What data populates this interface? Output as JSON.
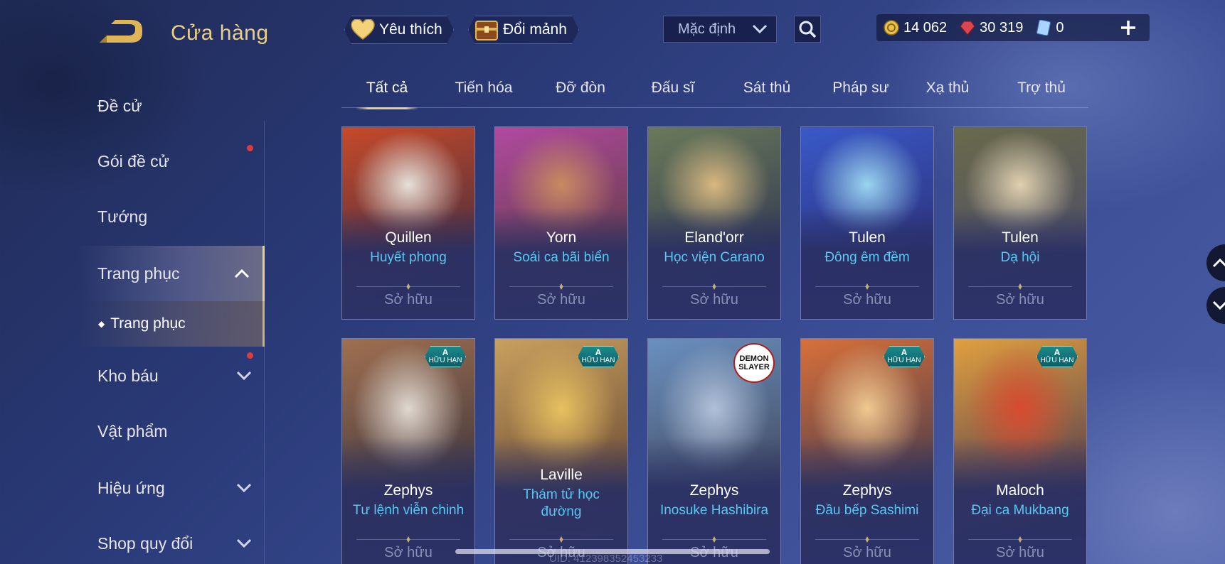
{
  "header": {
    "title": "Cửa hàng",
    "favorites_label": "Yêu thích",
    "exchange_label": "Đổi mảnh",
    "sort_value": "Mặc định"
  },
  "currencies": [
    {
      "name": "gold",
      "value": "14 062",
      "color": "#e8c04a"
    },
    {
      "name": "gem",
      "value": "30 319",
      "color": "#d8474f"
    },
    {
      "name": "voucher",
      "value": "0",
      "color": "#7fb6f0"
    }
  ],
  "sidebar": {
    "items": [
      {
        "label": "Đề cử"
      },
      {
        "label": "Gói đề cử"
      },
      {
        "label": "Tướng"
      },
      {
        "label": "Trang phục"
      },
      {
        "label": "Trang phục"
      },
      {
        "label": "Kho báu"
      },
      {
        "label": "Vật phẩm"
      },
      {
        "label": "Hiệu ứng"
      },
      {
        "label": "Shop quy đổi"
      }
    ]
  },
  "tabs": [
    "Tất cả",
    "Tiến hóa",
    "Đỡ đòn",
    "Đấu sĩ",
    "Sát thủ",
    "Pháp sư",
    "Xạ thủ",
    "Trợ thủ"
  ],
  "cards": [
    {
      "hero": "Quillen",
      "skin": "Huyết phong",
      "status": "Sở hữu",
      "badge": "",
      "art": [
        "#c64a2a",
        "#e6e0d8",
        "#3a2a40"
      ]
    },
    {
      "hero": "Yorn",
      "skin": "Soái ca bãi biển",
      "status": "Sở hữu",
      "badge": "",
      "art": [
        "#b04aa0",
        "#c88a60",
        "#5a3a3a"
      ]
    },
    {
      "hero": "Eland'orr",
      "skin": "Học viện Carano",
      "status": "Sở hữu",
      "badge": "",
      "art": [
        "#6a7a5a",
        "#d8b880",
        "#2a3050"
      ]
    },
    {
      "hero": "Tulen",
      "skin": "Đông êm đềm",
      "status": "Sở hữu",
      "badge": "",
      "art": [
        "#3a5ac8",
        "#9ad4f0",
        "#2a2a70"
      ]
    },
    {
      "hero": "Tulen",
      "skin": "Dạ hội",
      "status": "Sở hữu",
      "badge": "",
      "art": [
        "#6a6a4a",
        "#e0d0b0",
        "#4a4a6a"
      ]
    },
    {
      "hero": "Zephys",
      "skin": "Tư lệnh viễn chinh",
      "status": "Sở hữu",
      "badge": "A",
      "art": [
        "#a07050",
        "#e0d8d0",
        "#2a2a3a"
      ]
    },
    {
      "hero": "Laville",
      "skin": "Thám tử học đường",
      "status": "Sở hữu",
      "badge": "A",
      "art": [
        "#c8a060",
        "#e8c060",
        "#5a3a2a"
      ]
    },
    {
      "hero": "Zephys",
      "skin": "Inosuke Hashibira",
      "status": "Sở hữu",
      "badge": "DEMON SLAYER",
      "art": [
        "#6a90c0",
        "#b0c0d8",
        "#3a3a4a"
      ]
    },
    {
      "hero": "Zephys",
      "skin": "Đầu bếp Sashimi",
      "status": "Sở hữu",
      "badge": "A",
      "art": [
        "#d8703a",
        "#f0c890",
        "#2a3050"
      ]
    },
    {
      "hero": "Maloch",
      "skin": "Đại ca Mukbang",
      "status": "Sở hữu",
      "badge": "A",
      "art": [
        "#e0a040",
        "#d84a30",
        "#3a2a50"
      ]
    }
  ],
  "badge_text": {
    "grade": "A",
    "limited": "HỮU HẠN",
    "ds_line1": "DEMON",
    "ds_line2": "SLAYER"
  },
  "uid": "UID: 412398352453233"
}
